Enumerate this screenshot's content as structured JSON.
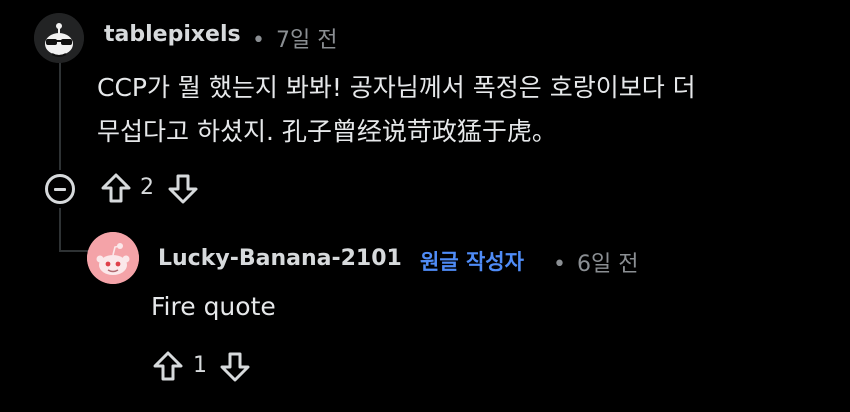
{
  "comment": {
    "username": "tablepixels",
    "separator": "•",
    "time": "7일 전",
    "body_line1": "CCP가 뭘 했는지 봐봐! 공자님께서 폭정은 호랑이보다 더",
    "body_line2": "무섭다고 하셨지. 孔子曾经说苛政猛于虎。",
    "score": "2"
  },
  "reply": {
    "username": "Lucky-Banana-2101",
    "op_badge": "원글 작성자",
    "separator": "•",
    "time": "6일 전",
    "body": "Fire quote",
    "score": "1"
  },
  "icons": {
    "upvote": "arrow-up-outline-icon",
    "downvote": "arrow-down-outline-icon",
    "collapse": "minus-circle-icon"
  },
  "colors": {
    "background": "#000000",
    "op_badge": "#4f8cf7",
    "meta": "#8b8f93"
  }
}
